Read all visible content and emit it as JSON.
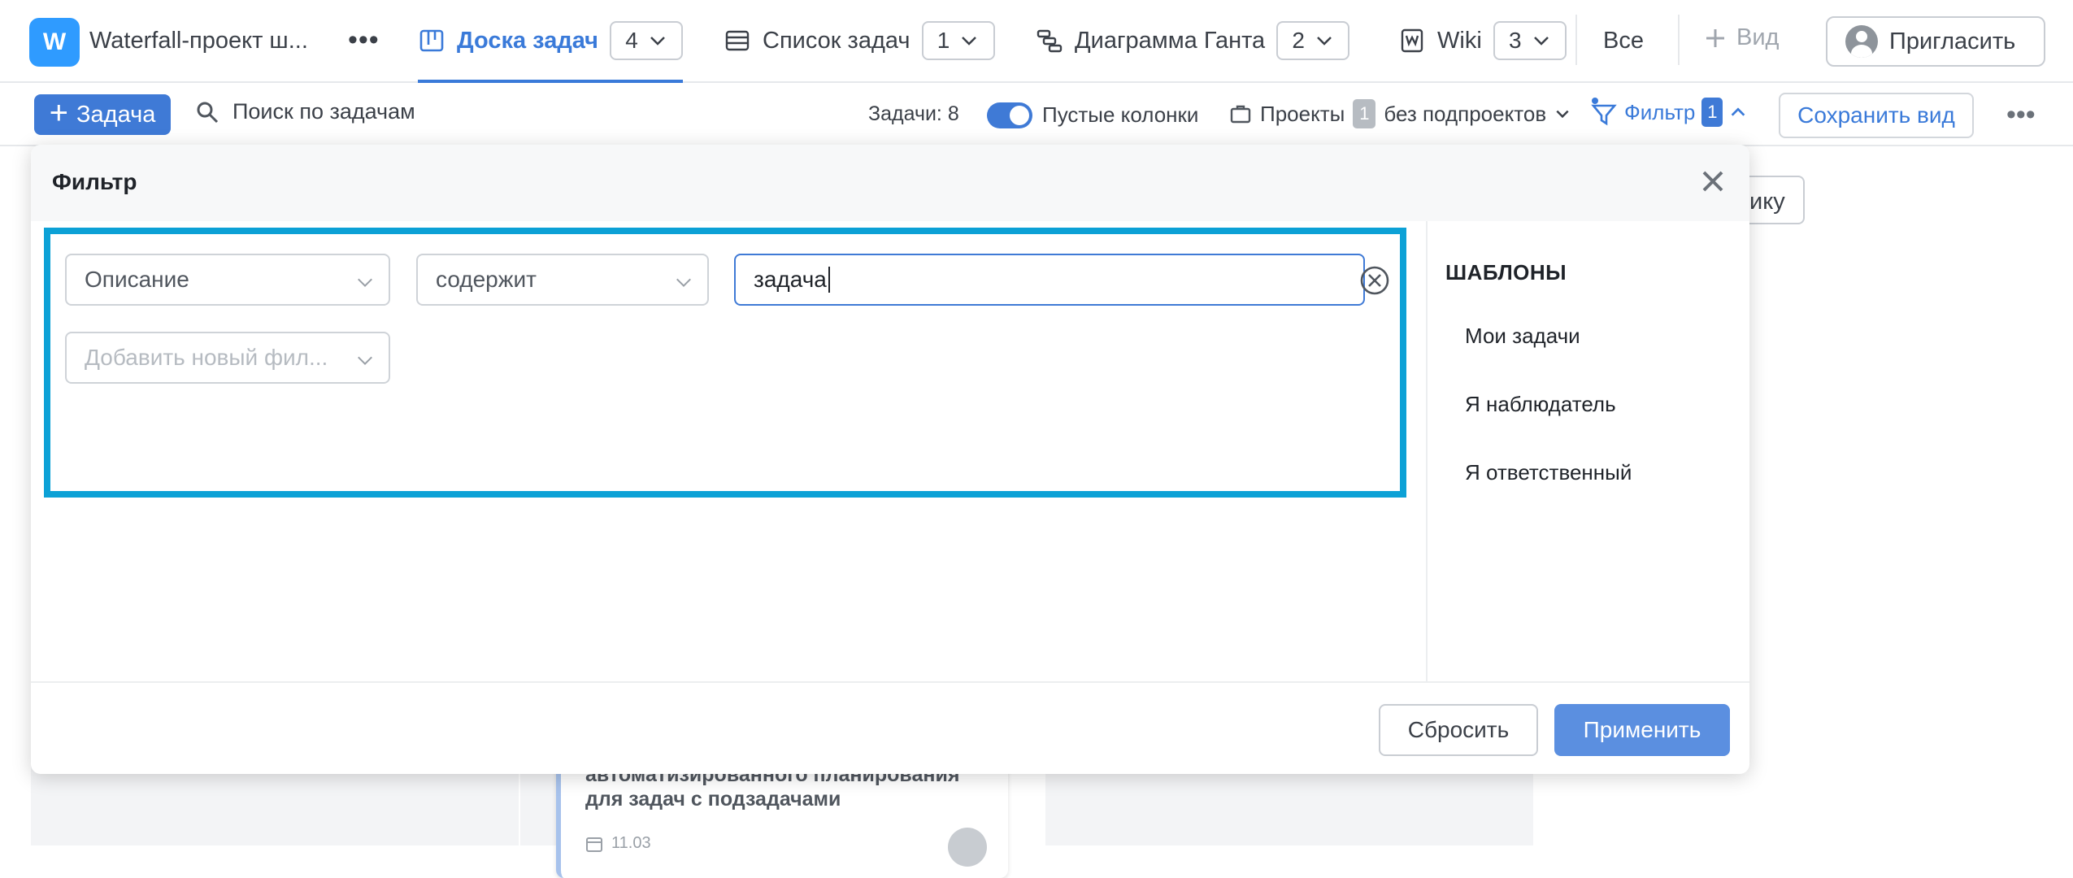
{
  "workspace": {
    "badge": "W",
    "name": "Waterfall-проект ш..."
  },
  "view_tabs": [
    {
      "label": "Доска задач",
      "count": "4",
      "icon": "board-icon",
      "active": true
    },
    {
      "label": "Список задач",
      "count": "1",
      "icon": "list-icon",
      "active": false
    },
    {
      "label": "Диаграмма Ганта",
      "count": "2",
      "icon": "gantt-icon",
      "active": false
    },
    {
      "label": "Wiki",
      "count": "3",
      "icon": "wiki-icon",
      "active": false
    }
  ],
  "top_right": {
    "all_label": "Все",
    "add_view_label": "Вид",
    "invite_label": "Пригласить"
  },
  "toolbar": {
    "task_button_label": "Задача",
    "search_label": "Поиск по задачам",
    "tasks_count": "Задачи: 8",
    "empty_columns_label": "Пустые колонки",
    "projects_label": "Проекты",
    "projects_badge": "1",
    "projects_suffix": "без подпроектов",
    "filter_label": "Фильтр",
    "filter_badge": "1",
    "save_view_label": "Сохранить вид"
  },
  "board": {
    "ghost_button_fragment": "ику",
    "card_title": "автоматизированного планирования для задач с подзадачами",
    "card_date": "11.03"
  },
  "filter_modal": {
    "title": "Фильтр",
    "field_select": "Описание",
    "operator_select": "содержит",
    "value_input": "задача",
    "add_filter_placeholder": "Добавить новый фил...",
    "templates_heading": "ШАБЛОНЫ",
    "templates": [
      "Мои задачи",
      "Я наблюдатель",
      "Я ответственный"
    ],
    "reset_label": "Сбросить",
    "apply_label": "Применить"
  },
  "colors": {
    "accent": "#3f7ad6",
    "highlight_border": "#0ca1d6",
    "workspace_badge": "#2f9bff"
  }
}
